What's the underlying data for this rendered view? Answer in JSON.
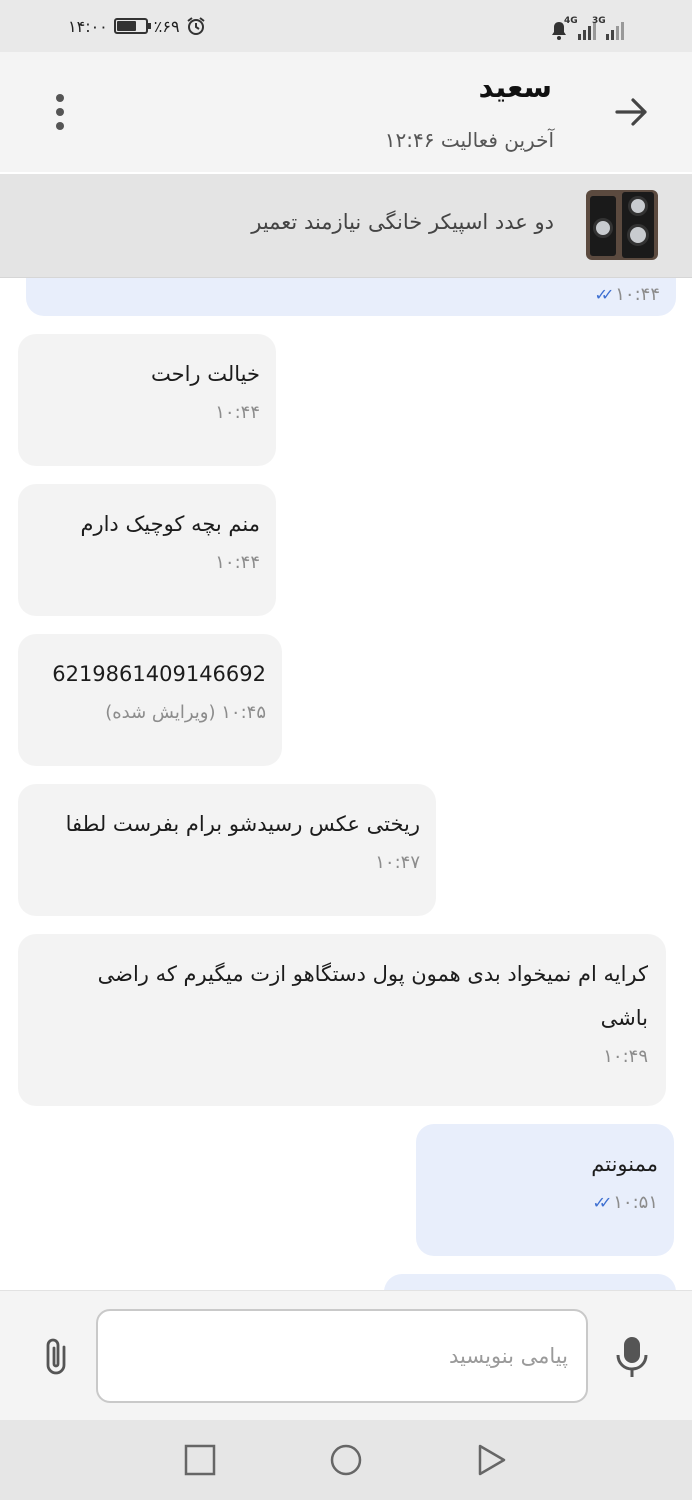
{
  "status_bar": {
    "time": "۱۴:۰۰",
    "battery": "٪۶۹",
    "battery_level": 0.69,
    "network_1": "4G",
    "network_2": "3G",
    "icons": [
      "alarm-icon",
      "battery-icon",
      "silent-bell-icon",
      "signal-icon"
    ]
  },
  "header": {
    "title": "سعید",
    "subtitle": "آخرین فعالیت ۱۲:۴۶",
    "icons": [
      "back-arrow-icon",
      "more-vert-icon"
    ]
  },
  "ad": {
    "title": "دو عدد اسپیکر خانگی نیازمند تعمیر"
  },
  "messages": [
    {
      "type": "sent",
      "text": "",
      "time": "۱۰:۴۴",
      "status": "read"
    },
    {
      "type": "received",
      "text": "خیالت راحت",
      "time": "۱۰:۴۴"
    },
    {
      "type": "received",
      "text": "منم بچه کوچیک دارم",
      "time": "۱۰:۴۴"
    },
    {
      "type": "received",
      "text": "6219861409146692",
      "time": "۱۰:۴۵ (ویرایش شده)"
    },
    {
      "type": "received",
      "text": "ریختی عکس رسیدشو برام بفرست لطفا",
      "time": "۱۰:۴۷"
    },
    {
      "type": "received",
      "text": "کرایه ام نمیخواد بدی همون پول دستگاهو ازت میگیرم که راضی باشی",
      "time": "۱۰:۴۹"
    },
    {
      "type": "sent",
      "text": "ممنونتم",
      "time": "۱۰:۵۱",
      "status": "read"
    }
  ],
  "composer": {
    "placeholder": "پیامی بنویسید",
    "value": "",
    "icons": [
      "mic-icon",
      "attach-icon"
    ]
  },
  "nav_bar": {
    "icons": [
      "recents-icon",
      "home-icon",
      "back-icon"
    ]
  },
  "colors": {
    "sent_bubble": "#e8eefb",
    "received_bubble": "#f3f3f3",
    "header_bg": "#f4f4f4",
    "read_check": "#3d6fd1"
  }
}
